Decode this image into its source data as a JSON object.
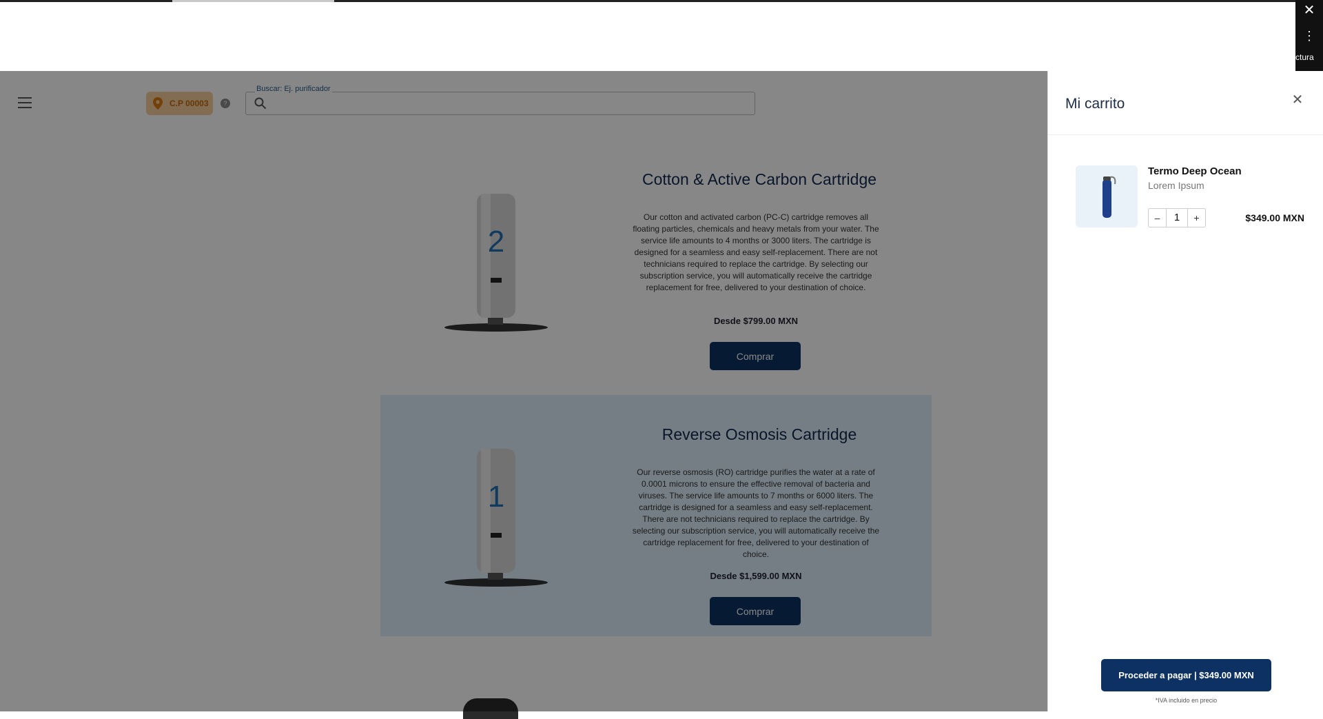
{
  "browser": {
    "close_glyph": "✕",
    "more_glyph": "⋮",
    "side_text": "ctura"
  },
  "header": {
    "location_label": "C.P 00003",
    "info_glyph": "?",
    "search_label": "Buscar: Ej. purificador",
    "search_value": ""
  },
  "products": [
    {
      "title": "Cotton & Active Carbon Cartridge",
      "number": "2",
      "description": "Our cotton and activated carbon (PC-C) cartridge removes all floating particles, chemicals and heavy metals from your water. The service life amounts to 4 months or 3000 liters. The cartridge is designed for a seamless and easy self-replacement. There are not technicians required to replace the cartridge. By selecting our subscription service, you will automatically receive the cartridge replacement for free, delivered to your destination of choice.",
      "price": "Desde $799.00 MXN",
      "buy_label": "Comprar"
    },
    {
      "title": "Reverse Osmosis Cartridge",
      "number": "1",
      "description": "Our reverse osmosis (RO) cartridge purifies the water at a rate of 0.0001 microns to ensure the effective removal of bacteria and viruses. The service life amounts to 7 months or 6000 liters. The cartridge is designed for a seamless and easy self-replacement. There are not technicians required to replace the cartridge. By selecting our subscription service, you will automatically receive the cartridge replacement for free, delivered to your destination of choice.",
      "price": "Desde $1,599.00 MXN",
      "buy_label": "Comprar"
    }
  ],
  "cart": {
    "title": "Mi carrito",
    "close_glyph": "✕",
    "item": {
      "name": "Termo Deep Ocean",
      "subtitle": "Lorem Ipsum",
      "minus": "–",
      "quantity": "1",
      "plus": "+",
      "price": "$349.00 MXN"
    },
    "checkout_label": "Proceder a pagar | $349.00 MXN",
    "tax_note": "*IVA incluido en precio"
  },
  "colors": {
    "primary": "#0d3162",
    "location_bg": "#f7cf9b",
    "location_fg": "#c06a10",
    "card_alt_bg": "#dbeefa"
  }
}
